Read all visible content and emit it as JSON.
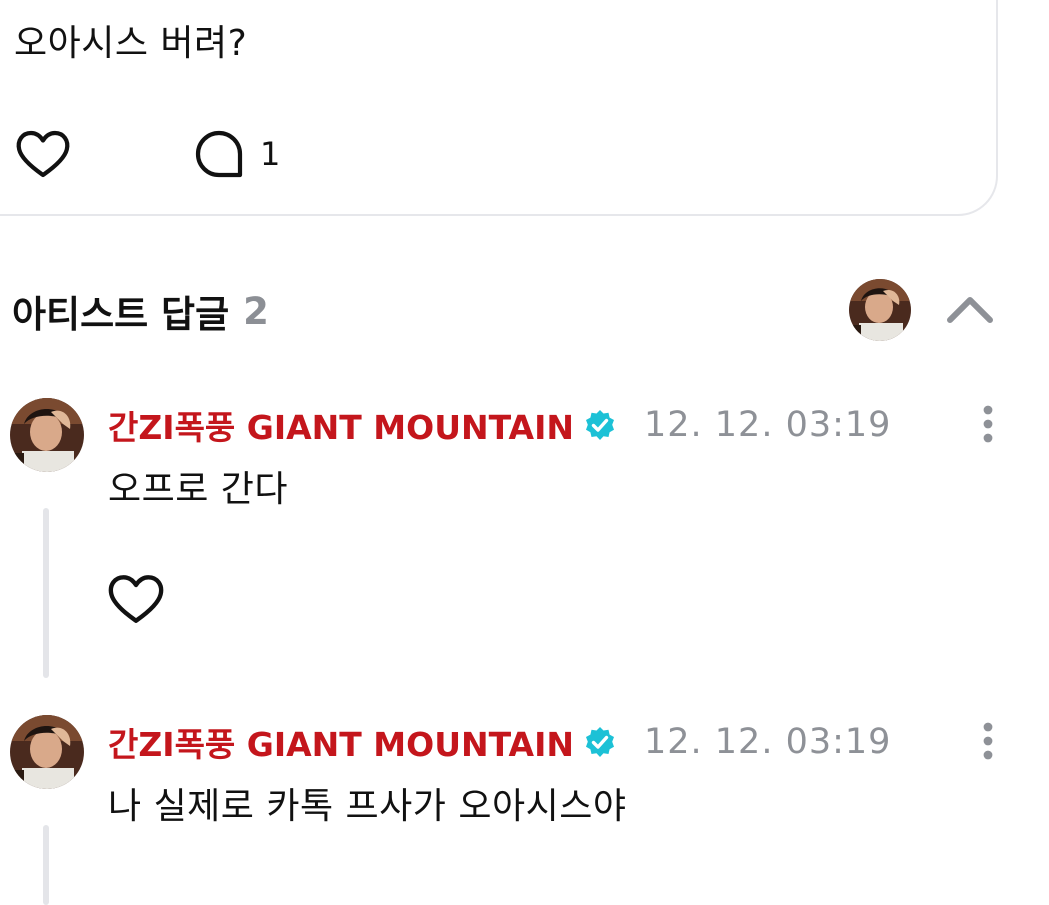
{
  "post": {
    "text": "오아시스 버려?",
    "comment_count": "1"
  },
  "section": {
    "title": "아티스트 답글",
    "count": "2"
  },
  "replies": [
    {
      "author": "간ZI폭풍 GIANT MOUNTAIN",
      "time": "12. 12. 03:19",
      "text": "오프로 간다"
    },
    {
      "author": "간ZI폭풍 GIANT MOUNTAIN",
      "time": "12. 12. 03:19",
      "text": "나 실제로 카톡 프사가 오아시스야"
    }
  ],
  "icons": {
    "like": "heart-outline-icon",
    "comment": "speech-bubble-icon",
    "collapse": "chevron-up-icon",
    "more": "more-vertical-icon",
    "verified": "verified-badge-icon"
  },
  "colors": {
    "author": "#c4161c",
    "verified": "#1cc1d6",
    "muted": "#8e9197",
    "divider": "#e4e5e9"
  }
}
